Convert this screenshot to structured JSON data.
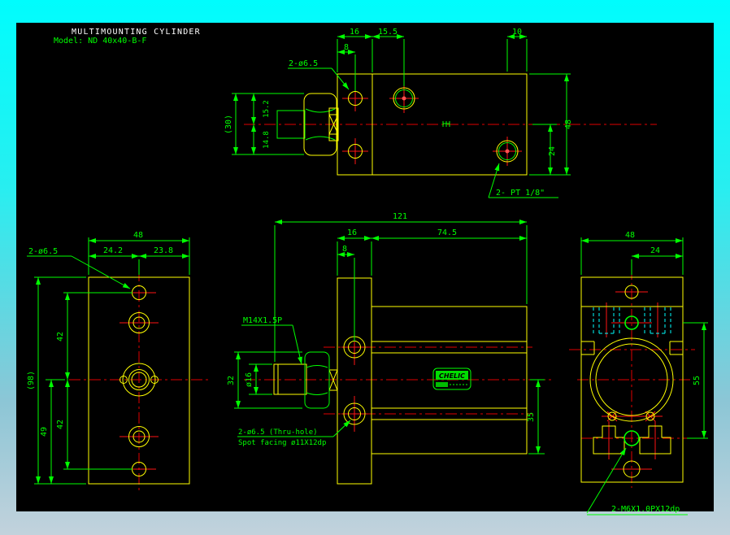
{
  "colors": {
    "part": "#ffff00",
    "dimension": "#00ff00",
    "centerline": "#e00000",
    "hidden": "#00ffff",
    "background_top": "#00fdfd",
    "background_bottom": "#c2d2dc",
    "canvas": "#000000",
    "title_text": "#ffffff"
  },
  "title_block": {
    "title": "MULTIMOUNTING CYLINDER",
    "model": "Model: ND 40x40-B-F"
  },
  "logo": {
    "brand": "CHELIC"
  },
  "top_view": {
    "hole_label": "2-ø6.5",
    "port_label": "2- PT 1/8\"",
    "dims": {
      "width_16": "16",
      "width_15_5": "15.5",
      "width_10": "10",
      "width_8": "8",
      "height_48": "48",
      "height_24": "24",
      "overall_30": "(30)",
      "upper_15_2": "15.2",
      "lower_14_8": "14.8"
    }
  },
  "left_view": {
    "hole_label": "2-ø6.5",
    "dims": {
      "width_48": "48",
      "left_24_2": "24.2",
      "right_23_8": "23.8",
      "height_98": "(98)",
      "upper_42": "42",
      "lower_42": "42",
      "offset_49": "49"
    }
  },
  "front_view": {
    "thread_label": "M14X1.5P",
    "thru_label": "2-ø6.5 (Thru-hole)",
    "spot_label": "Spot facing ø11X12dp",
    "dims": {
      "length_121": "121",
      "width_16": "16",
      "length_74_5": "74.5",
      "width_8": "8",
      "nut_32": "32",
      "rod_dia": "ø16",
      "height_35": "35"
    }
  },
  "right_view": {
    "tap_label": "2-M6X1.0PX12dp",
    "dims": {
      "width_48": "48",
      "offset_24": "24",
      "height_55": "55"
    }
  }
}
